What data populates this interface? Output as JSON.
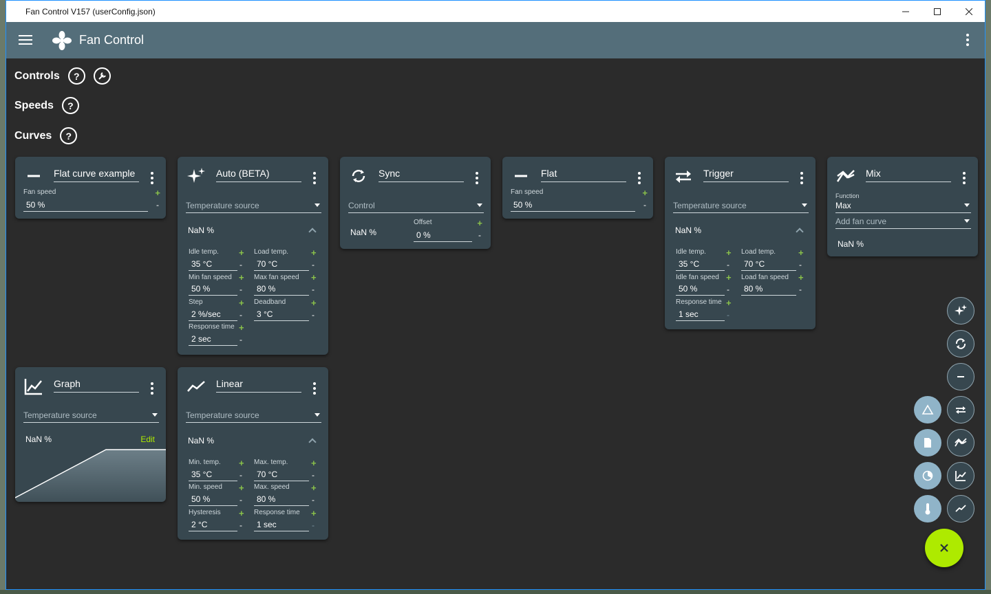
{
  "window": {
    "title": "Fan Control V157 (userConfig.json)"
  },
  "appbar": {
    "title": "Fan Control"
  },
  "sections": {
    "controls": "Controls",
    "speeds": "Speeds",
    "curves": "Curves",
    "help_glyph": "?"
  },
  "common": {
    "temperature_source": "Temperature source",
    "nan": "NaN %",
    "plus": "+",
    "minus": "-"
  },
  "cards": {
    "flat_curve": {
      "name": "Flat curve example",
      "fan_speed_label": "Fan speed",
      "fan_speed_value": "50 %"
    },
    "auto": {
      "name": "Auto (BETA)",
      "idle_temp_label": "Idle temp.",
      "idle_temp_value": "35 °C",
      "load_temp_label": "Load temp.",
      "load_temp_value": "70 °C",
      "min_fan_label": "Min fan speed",
      "min_fan_value": "50 %",
      "max_fan_label": "Max fan speed",
      "max_fan_value": "80 %",
      "step_label": "Step",
      "step_value": "2 %/sec",
      "deadband_label": "Deadband",
      "deadband_value": "3 °C",
      "response_label": "Response time",
      "response_value": "2 sec"
    },
    "sync": {
      "name": "Sync",
      "control_label": "Control",
      "offset_label": "Offset",
      "offset_value": "0 %"
    },
    "flat": {
      "name": "Flat",
      "fan_speed_label": "Fan speed",
      "fan_speed_value": "50 %"
    },
    "trigger": {
      "name": "Trigger",
      "idle_temp_label": "Idle temp.",
      "idle_temp_value": "35 °C",
      "load_temp_label": "Load temp.",
      "load_temp_value": "70 °C",
      "idle_fan_label": "Idle fan speed",
      "idle_fan_value": "50 %",
      "load_fan_label": "Load fan speed",
      "load_fan_value": "80 %",
      "response_label": "Response time",
      "response_value": "1 sec"
    },
    "mix": {
      "name": "Mix",
      "function_label": "Function",
      "function_value": "Max",
      "add_curve": "Add fan curve"
    },
    "graph": {
      "name": "Graph",
      "edit": "Edit"
    },
    "linear": {
      "name": "Linear",
      "min_temp_label": "Min. temp.",
      "min_temp_value": "35 °C",
      "max_temp_label": "Max. temp.",
      "max_temp_value": "70 °C",
      "min_speed_label": "Min. speed",
      "min_speed_value": "50 %",
      "max_speed_label": "Max. speed",
      "max_speed_value": "80 %",
      "hysteresis_label": "Hysteresis",
      "hysteresis_value": "2 °C",
      "response_label": "Response time",
      "response_value": "1 sec"
    }
  },
  "colors": {
    "accent": "#aeea00",
    "appbar": "#546e7a",
    "card": "#37474f",
    "background": "#2b2b2b"
  }
}
